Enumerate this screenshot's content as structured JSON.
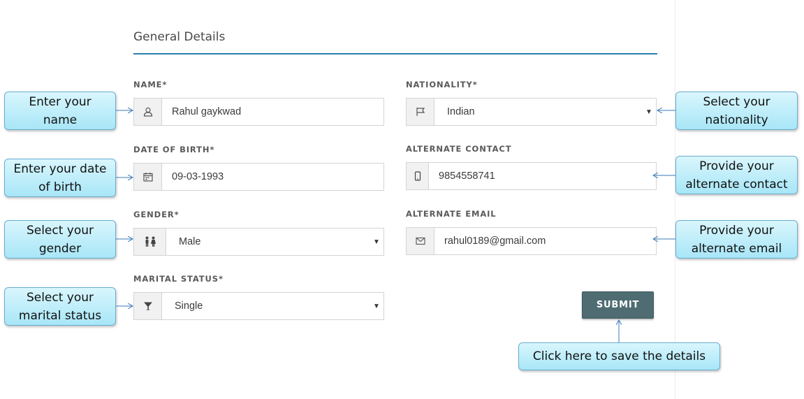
{
  "section": {
    "title": "General Details"
  },
  "fields": {
    "name": {
      "label": "NAME*",
      "value": "Rahul gaykwad",
      "icon": "user-icon"
    },
    "dob": {
      "label": "DATE OF BIRTH*",
      "value": "09-03-1993",
      "icon": "calendar-icon"
    },
    "gender": {
      "label": "GENDER*",
      "value": "Male",
      "icon": "people-icon"
    },
    "marital": {
      "label": "MARITAL STATUS*",
      "value": "Single",
      "icon": "cocktail-icon"
    },
    "nationality": {
      "label": "NATIONALITY*",
      "value": "Indian",
      "icon": "flag-icon"
    },
    "alt_contact": {
      "label": "ALTERNATE CONTACT",
      "value": "9854558741",
      "icon": "mobile-icon"
    },
    "alt_email": {
      "label": "ALTERNATE EMAIL",
      "value": "rahul0189@gmail.com",
      "icon": "envelope-icon"
    }
  },
  "submit_label": "SUBMIT",
  "callouts": {
    "name": "Enter your\nname",
    "dob": "Enter your date\nof birth",
    "gender": "Select your\ngender",
    "marital": "Select your\nmarital status",
    "nationality": "Select your\nnationality",
    "alt_contact": "Provide your\nalternate contact",
    "alt_email": "Provide your\nalternate email",
    "submit": "Click here to save the details"
  },
  "colors": {
    "accent_line": "#2b7fb0",
    "submit_bg": "#4e6c72",
    "callout_fill": "#bdeefa",
    "callout_border": "#6aaed0"
  }
}
